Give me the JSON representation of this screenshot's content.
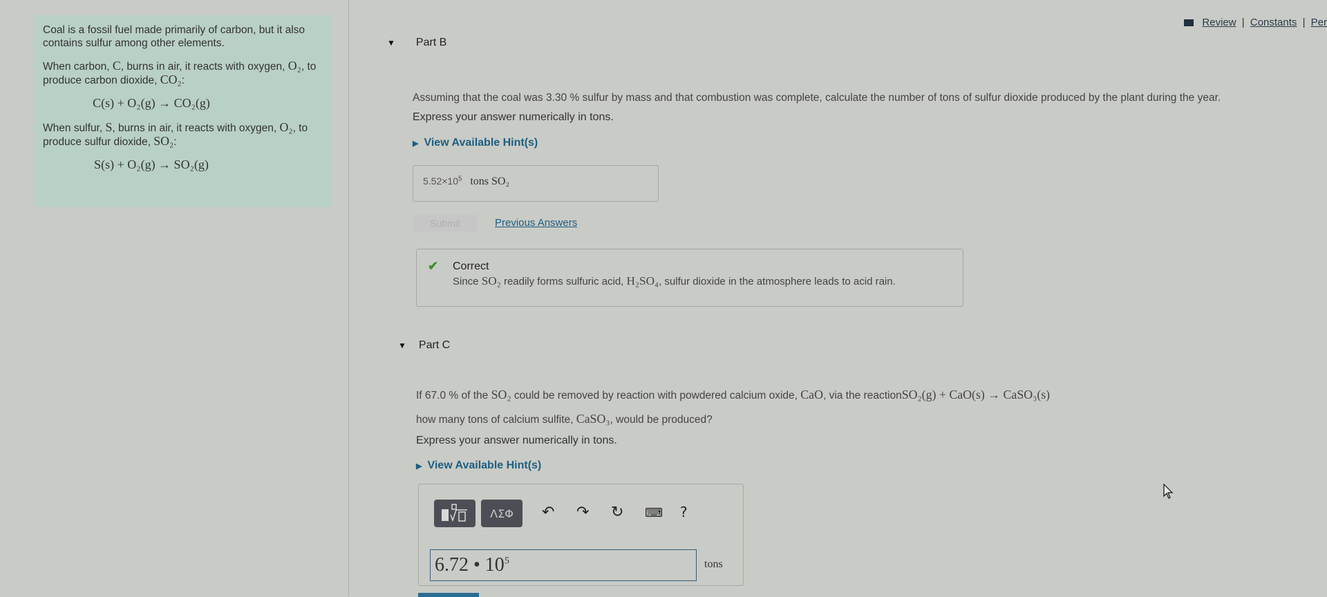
{
  "top_links": {
    "review": "Review",
    "constants": "Constants",
    "periodic": "Per",
    "separator": "|"
  },
  "intro": {
    "para1": "Coal is a fossil fuel made primarily of carbon, but it also contains sulfur among other elements.",
    "para2_pre": "When carbon, ",
    "para2_symbol": "C",
    "para2_mid": ", burns in air, it reacts with oxygen, ",
    "para2_o2": "O₂",
    "para2_post": ", to produce carbon dioxide, ",
    "para2_product": "CO₂",
    "para2_end": ":",
    "equation1": "C(s) + O₂(g) → CO₂(g)",
    "para3_pre": "When sulfur, ",
    "para3_symbol": "S",
    "para3_mid": ", burns in air, it reacts with oxygen, ",
    "para3_o2": "O₂",
    "para3_post": ", to produce sulfur dioxide, ",
    "para3_product": "SO₂",
    "para3_end": ":",
    "equation2": "S(s) + O₂(g) → SO₂(g)"
  },
  "part_b": {
    "title": "Part B",
    "question": "Assuming that the coal was 3.30 % sulfur by mass and that combustion was complete, calculate the number of tons of sulfur dioxide produced  by the plant during the year.",
    "express": "Express your answer numerically in tons.",
    "hint_label": "View Available Hint(s)",
    "answer_mantissa": "5.52×10",
    "answer_exponent": "5",
    "answer_unit": "tons SO₂",
    "submit_label": "Submit",
    "previous_answers_label": "Previous Answers",
    "feedback": {
      "status": "Correct",
      "body_pre": "Since ",
      "body_so2": "SO₂",
      "body_mid": " readily forms sulfuric acid, ",
      "body_h2so4": "H₂SO₄",
      "body_post": ", sulfur dioxide in the atmosphere leads to acid rain."
    }
  },
  "part_c": {
    "title": "Part C",
    "question_line1_pre": "If 67.0 % of the ",
    "question_line1_so2": "SO₂",
    "question_line1_mid": " could be removed by reaction with powdered calcium oxide, ",
    "question_line1_cao": "CaO",
    "question_line1_post": ", via the reaction",
    "question_line1_eq": "SO₂(g) + CaO(s) → CaSO₃(s)",
    "question_line2_pre": "how many tons of calcium sulfite, ",
    "question_line2_caso3": "CaSO₃",
    "question_line2_post": ", would be produced?",
    "express": "Express your answer numerically in tons.",
    "hint_label": "View Available Hint(s)",
    "toolbar": {
      "templates_icon": "templates-icon",
      "symbols_label": "ΛΣΦ",
      "undo_icon": "↶",
      "redo_icon": "↷",
      "reset_icon": "↻",
      "keyboard_icon": "⌨",
      "help_icon": "?"
    },
    "input_mantissa": "6.72 • 10",
    "input_exponent": "5",
    "unit": "tons"
  }
}
